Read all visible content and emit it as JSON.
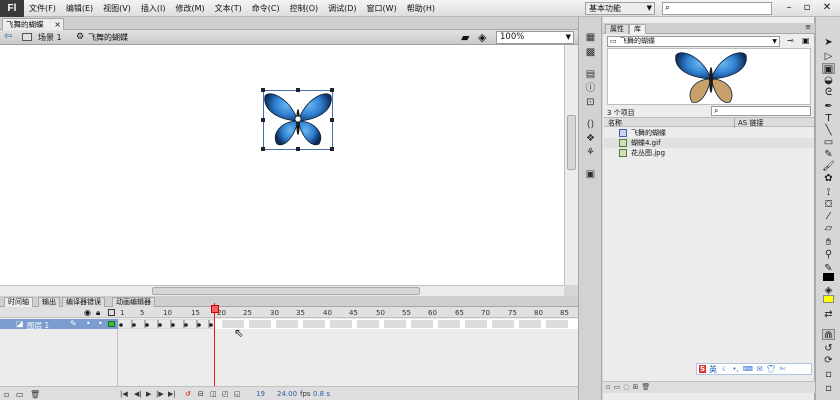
{
  "app": {
    "logo": "Fl"
  },
  "menu": [
    "文件(F)",
    "编辑(E)",
    "视图(V)",
    "插入(I)",
    "修改(M)",
    "文本(T)",
    "命令(C)",
    "控制(O)",
    "调试(D)",
    "窗口(W)",
    "帮助(H)"
  ],
  "workspace": {
    "label": "基本功能"
  },
  "document": {
    "tab_title": "飞舞的蝴蝶",
    "scene_label": "场景 1",
    "symbol_label": "飞舞的蝴蝶",
    "zoom": "100%"
  },
  "timeline": {
    "tabs": [
      "时间轴",
      "输出",
      "编译器错误",
      "动画编辑器"
    ],
    "layer_name": "图层 1",
    "frame_numbers": [
      "1",
      "5",
      "10",
      "15",
      "20",
      "25",
      "30",
      "35",
      "40",
      "45",
      "50",
      "55",
      "60",
      "65",
      "70",
      "75",
      "80",
      "85"
    ],
    "current_frame": "19",
    "fps": "24.00",
    "fps_unit": "fps",
    "time": "0.8 s"
  },
  "library": {
    "tabs": [
      "属性",
      "库"
    ],
    "document": "飞舞的蝴蝶",
    "item_count": "3 个项目",
    "col_name": "名称",
    "col_linkage": "AS 链接",
    "items": [
      {
        "name": "飞舞的蝴蝶",
        "type": "movieclip"
      },
      {
        "name": "蝴蝶4.gif",
        "type": "bitmap"
      },
      {
        "name": "花丛图.jpg",
        "type": "bitmap"
      }
    ]
  },
  "ime": {
    "brand": "S",
    "lang": "英"
  },
  "colors": {
    "layer_highlight": "#7a9ccf",
    "playhead": "#e02020",
    "butterfly_blue": "#2f7fd0"
  }
}
